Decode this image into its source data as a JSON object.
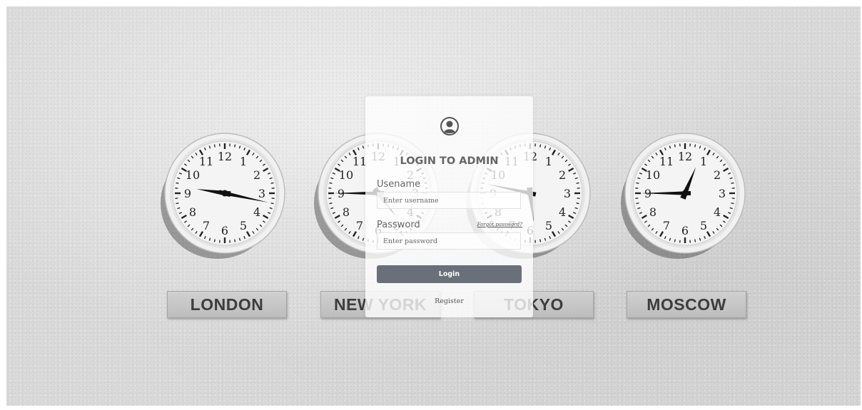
{
  "cities": [
    {
      "name": "LONDON",
      "hour": 9,
      "minute": 17
    },
    {
      "name": "NEW YORK",
      "hour": 4,
      "minute": 45
    },
    {
      "name": "TOKYO",
      "hour": 5,
      "minute": 47
    },
    {
      "name": "MOSCOW",
      "hour": 12,
      "minute": 45
    }
  ],
  "login": {
    "icon": "user-circle-icon",
    "title": "LOGIN TO ADMIN",
    "username_label": "Usename",
    "username_placeholder": "Enter username",
    "password_label": "Password",
    "forgot_label": "Forgot password?",
    "password_placeholder": "Enter password",
    "login_button": "Login",
    "register_label": "Register"
  },
  "colors": {
    "button": "#6a707a",
    "plate": "#c8c8c8",
    "wall": "#d9d9d9"
  }
}
